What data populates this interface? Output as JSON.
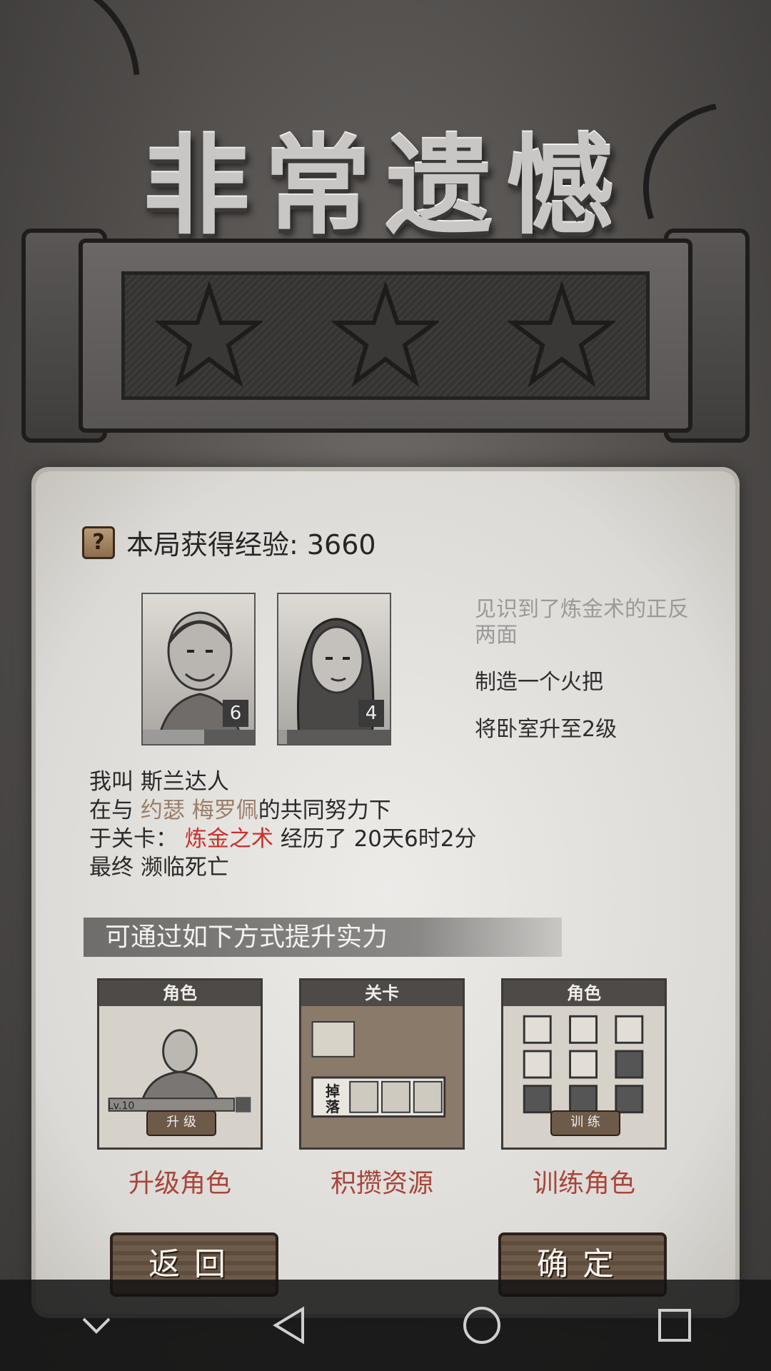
{
  "title": "非常遗憾",
  "stars": {
    "earned": 0,
    "total": 3
  },
  "summary": {
    "help_icon": "?",
    "xp_label": "本局获得经验: 3660"
  },
  "characters": [
    {
      "name": "斯兰达人",
      "level": "6",
      "xp_fraction": 0.55
    },
    {
      "name": "约瑟 梅罗佩",
      "level": "4",
      "xp_fraction": 0.08
    }
  ],
  "tasks": [
    {
      "text": "见识到了炼金术的正反两面",
      "status": "done"
    },
    {
      "text": "制造一个火把",
      "status": "pending"
    },
    {
      "text": "将卧室升至2级",
      "status": "pending"
    }
  ],
  "story": {
    "line1_prefix": "我叫 ",
    "line1_name": "斯兰达人",
    "line2_prefix": "在与 ",
    "line2_allies": "约瑟 梅罗佩",
    "line2_suffix": "的共同努力下",
    "line3_prefix": "于关卡： ",
    "line3_level": "炼金之术",
    "line3_suffix": " 经历了 20天6时2分",
    "line4": "最终 濒临死亡"
  },
  "improve": {
    "banner": "可通过如下方式提升实力",
    "cards": [
      {
        "header": "角色",
        "caption": "升级角色",
        "inner_label": "升 级",
        "inner_level": "Lv.10"
      },
      {
        "header": "关卡",
        "caption": "积攒资源",
        "inner_label": "掉落"
      },
      {
        "header": "角色",
        "caption": "训练角色",
        "inner_label": "训 练"
      }
    ]
  },
  "buttons": {
    "back": "返回",
    "confirm": "确定"
  },
  "navbar": {
    "icons": [
      "chevron-down-icon",
      "back-triangle-icon",
      "home-circle-icon",
      "recents-square-icon"
    ]
  },
  "colors": {
    "background": "#5b5856",
    "parchment": "#e4e2de",
    "accent_red": "#c8312b",
    "caption_red": "#a8453a",
    "ally_tan": "#9a7e6a"
  }
}
